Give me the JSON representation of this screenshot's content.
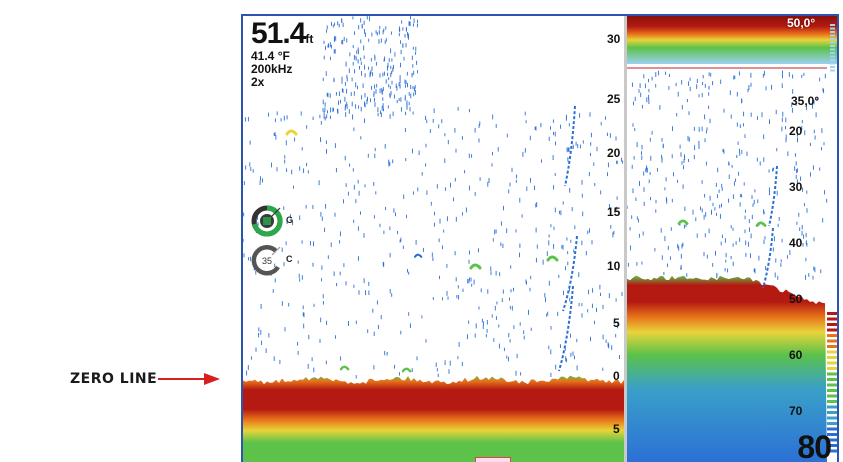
{
  "annotation": {
    "label": "ZERO LINE",
    "arrow_color": "#d81f1f"
  },
  "left_pane": {
    "depth_value": "51.4",
    "depth_unit": "ft",
    "temperature": "41.4 °F",
    "frequency": "200kHz",
    "zoom": "2x",
    "scale_labels": [
      "30",
      "25",
      "20",
      "15",
      "10",
      "5",
      "0",
      "5"
    ],
    "gain_control": {
      "value": "",
      "letter": "G",
      "icon": "gain-dial-icon",
      "color": "#2aa84a"
    },
    "color_control": {
      "value": "35",
      "letter": "C",
      "icon": "color-dial-icon",
      "color": "#666666"
    }
  },
  "right_pane": {
    "top_label": "50,0°",
    "sub_label": "35,0°",
    "scale_labels": [
      "20",
      "30",
      "40",
      "50",
      "60",
      "70"
    ],
    "range": "80"
  },
  "colors": {
    "frame_border": "#2a55b0",
    "sonar_red": "#b51a12",
    "sonar_orange": "#e8741a",
    "sonar_yellow": "#e8d43a",
    "sonar_green": "#5cc24a",
    "sonar_blue": "#2b6fd6"
  }
}
